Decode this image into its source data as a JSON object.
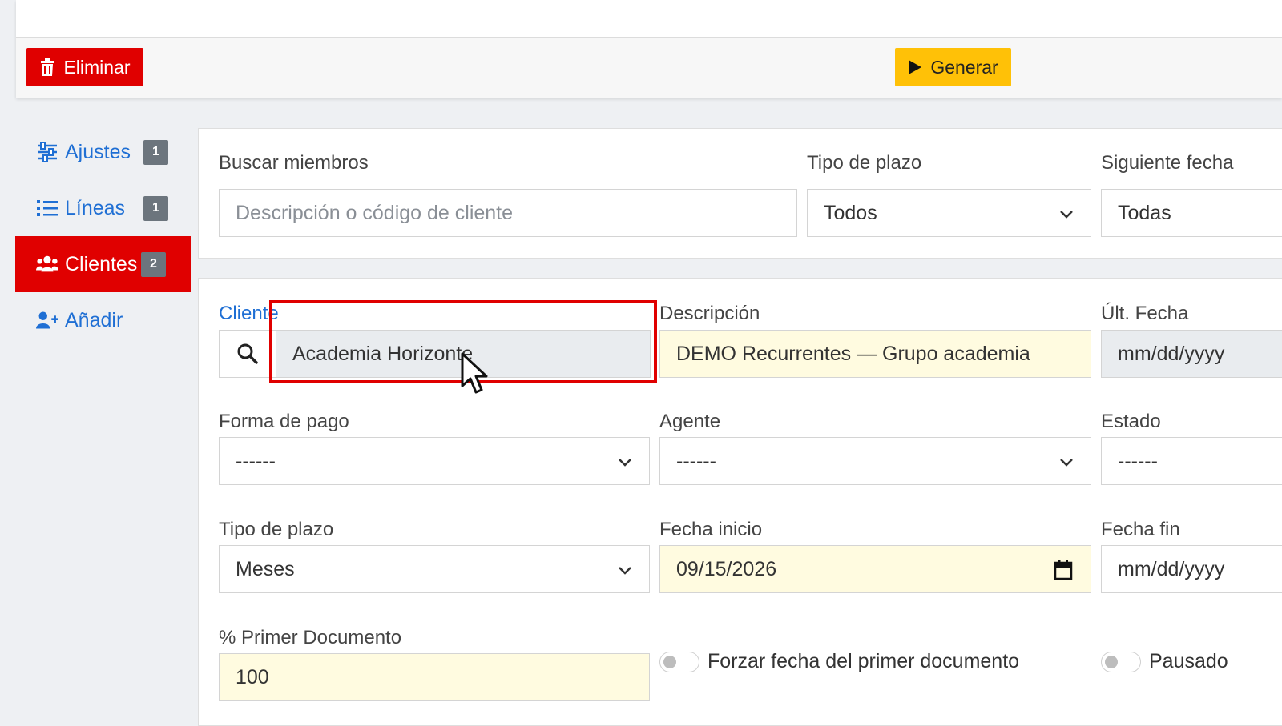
{
  "toolbar": {
    "delete_label": "Eliminar",
    "generate_label": "Generar",
    "delete_color": "#e00000",
    "generate_color": "#ffc107"
  },
  "sidebar": {
    "items": [
      {
        "label": "Ajustes",
        "badge": "1",
        "icon": "sliders-icon"
      },
      {
        "label": "Líneas",
        "badge": "1",
        "icon": "list-icon"
      },
      {
        "label": "Clientes",
        "badge": "2",
        "icon": "users-icon",
        "active": true
      },
      {
        "label": "Añadir",
        "icon": "user-plus-icon"
      }
    ]
  },
  "filters": {
    "search_label": "Buscar miembros",
    "search_placeholder": "Descripción o código de cliente",
    "term_type_label": "Tipo de plazo",
    "term_type_value": "Todos",
    "next_date_label": "Siguiente fecha",
    "next_date_value": "Todas"
  },
  "form": {
    "client_label": "Cliente",
    "client_value": "Academia Horizonte",
    "description_label": "Descripción",
    "description_value": "DEMO Recurrentes — Grupo academia",
    "last_date_label": "Últ. Fecha",
    "last_date_value": "mm/dd/yyyy",
    "payment_label": "Forma de pago",
    "payment_value": "------",
    "agent_label": "Agente",
    "agent_value": "------",
    "status_label": "Estado",
    "status_value": "------",
    "term_label": "Tipo de plazo",
    "term_value": "Meses",
    "start_label": "Fecha inicio",
    "start_value": "09/15/2026",
    "end_label": "Fecha fin",
    "end_value": "mm/dd/yyyy",
    "first_doc_label": "% Primer Documento",
    "first_doc_value": "100",
    "force_date_label": "Forzar fecha del primer documento",
    "paused_label": "Pausado"
  }
}
